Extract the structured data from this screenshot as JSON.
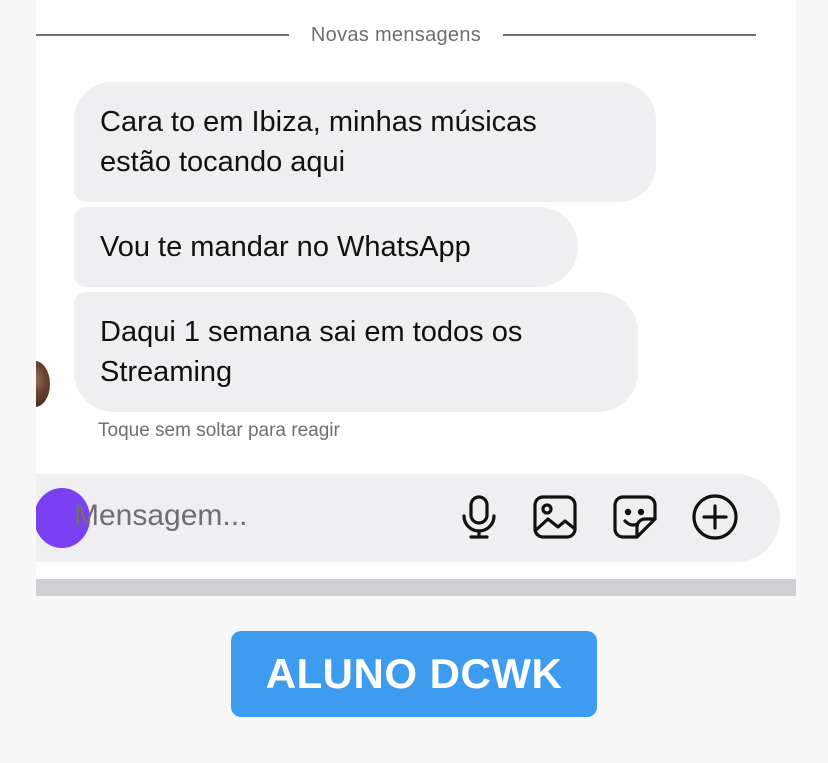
{
  "divider": {
    "label": "Novas mensagens"
  },
  "messages": [
    {
      "text_line1": "Cara to em Ibiza, minhas músicas",
      "text_line2": "estão tocando aqui"
    },
    {
      "text_line1": "Vou te mandar no WhatsApp"
    },
    {
      "text_line1": "Daqui 1 semana sai em todos os",
      "text_line2": "Streaming"
    }
  ],
  "hint": "Toque sem soltar para reagir",
  "composer": {
    "placeholder": "Mensagem...",
    "icons": [
      "microphone-icon",
      "image-icon",
      "sticker-icon",
      "plus-circle-icon"
    ]
  },
  "watermark": "ALUNO DCWK",
  "colors": {
    "bubble": "#efeff1",
    "accent_camera": "#7b3ff2",
    "watermark_bg": "#3d9bf0"
  }
}
